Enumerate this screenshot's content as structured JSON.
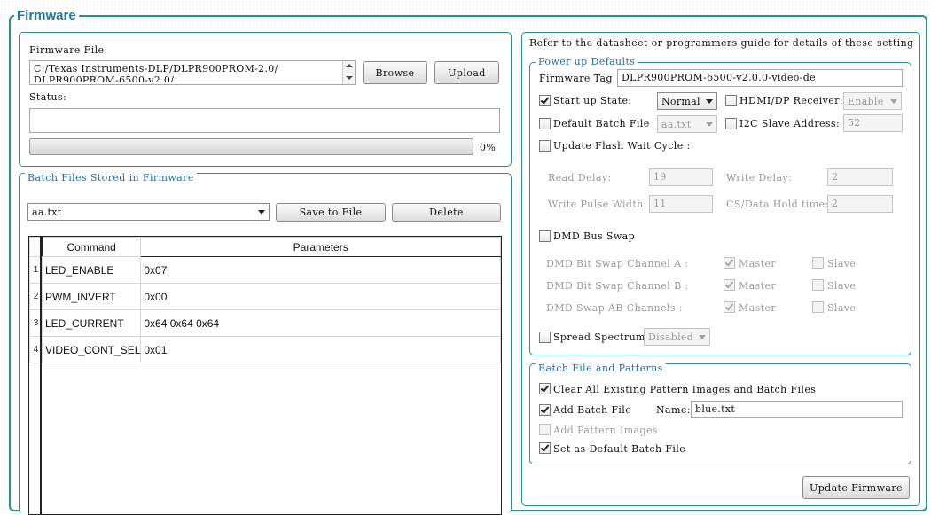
{
  "title": "Firmware",
  "firmware_file": {
    "label": "Firmware File:",
    "path_line1": "C:/Texas Instruments-DLP/DLPR900PROM-2.0/",
    "path_line2": "DLPR900PROM-6500-v2.0/",
    "browse": "Browse",
    "upload": "Upload",
    "status_label": "Status:",
    "status_value": "",
    "progress_text": "0%",
    "progress": 0
  },
  "batch": {
    "legend": "Batch Files Stored in Firmware",
    "selected": "aa.txt",
    "save": "Save to File",
    "delete": "Delete",
    "columns": [
      "Command",
      "Parameters"
    ],
    "rows": [
      {
        "n": "1",
        "command": "LED_ENABLE",
        "params": "0x07"
      },
      {
        "n": "2",
        "command": "PWM_INVERT",
        "params": "0x00"
      },
      {
        "n": "3",
        "command": "LED_CURRENT",
        "params": "0x64 0x64 0x64"
      },
      {
        "n": "4",
        "command": "VIDEO_CONT_SEL",
        "params": "0x01"
      }
    ]
  },
  "right": {
    "note": "Refer to the datasheet or programmers guide for details of these setting",
    "powerup": {
      "legend": "Power up Defaults",
      "tag_label": "Firmware Tag :",
      "tag_value": "DLPR900PROM-6500-v2.0.0-video-de",
      "startup_label": "Start up State:",
      "startup_value": "Normal",
      "hdmi_label": "HDMI/DP Receiver:",
      "hdmi_value": "Enable",
      "default_batch_label": "Default Batch File",
      "default_batch_value": "aa.txt",
      "i2c_label": "I2C Slave Address:",
      "i2c_value": "52",
      "flash_label": "Update Flash Wait Cycle :",
      "read_delay_label": "Read Delay:",
      "read_delay": "19",
      "write_delay_label": "Write Delay:",
      "write_delay": "2",
      "pulse_label": "Write Pulse Width:",
      "pulse": "11",
      "cs_label": "CS/Data Hold time:",
      "cs": "2",
      "dmd_bus_label": "DMD Bus Swap",
      "swap_a_label": "DMD Bit Swap Channel A :",
      "swap_b_label": "DMD Bit Swap Channel B :",
      "swap_ab_label": "DMD Swap AB Channels :",
      "master": "Master",
      "slave": "Slave",
      "spread_label": "Spread Spectrum",
      "spread_value": "Disabled"
    },
    "batchpat": {
      "legend": "Batch File and Patterns",
      "clear_label": "Clear All Existing Pattern Images and Batch Files",
      "add_batch_label": "Add Batch File",
      "name_label": "Name:",
      "name_value": "blue.txt",
      "add_pattern_label": "Add Pattern Images",
      "set_default_label": "Set as Default Batch File"
    },
    "update": "Update Firmware"
  }
}
